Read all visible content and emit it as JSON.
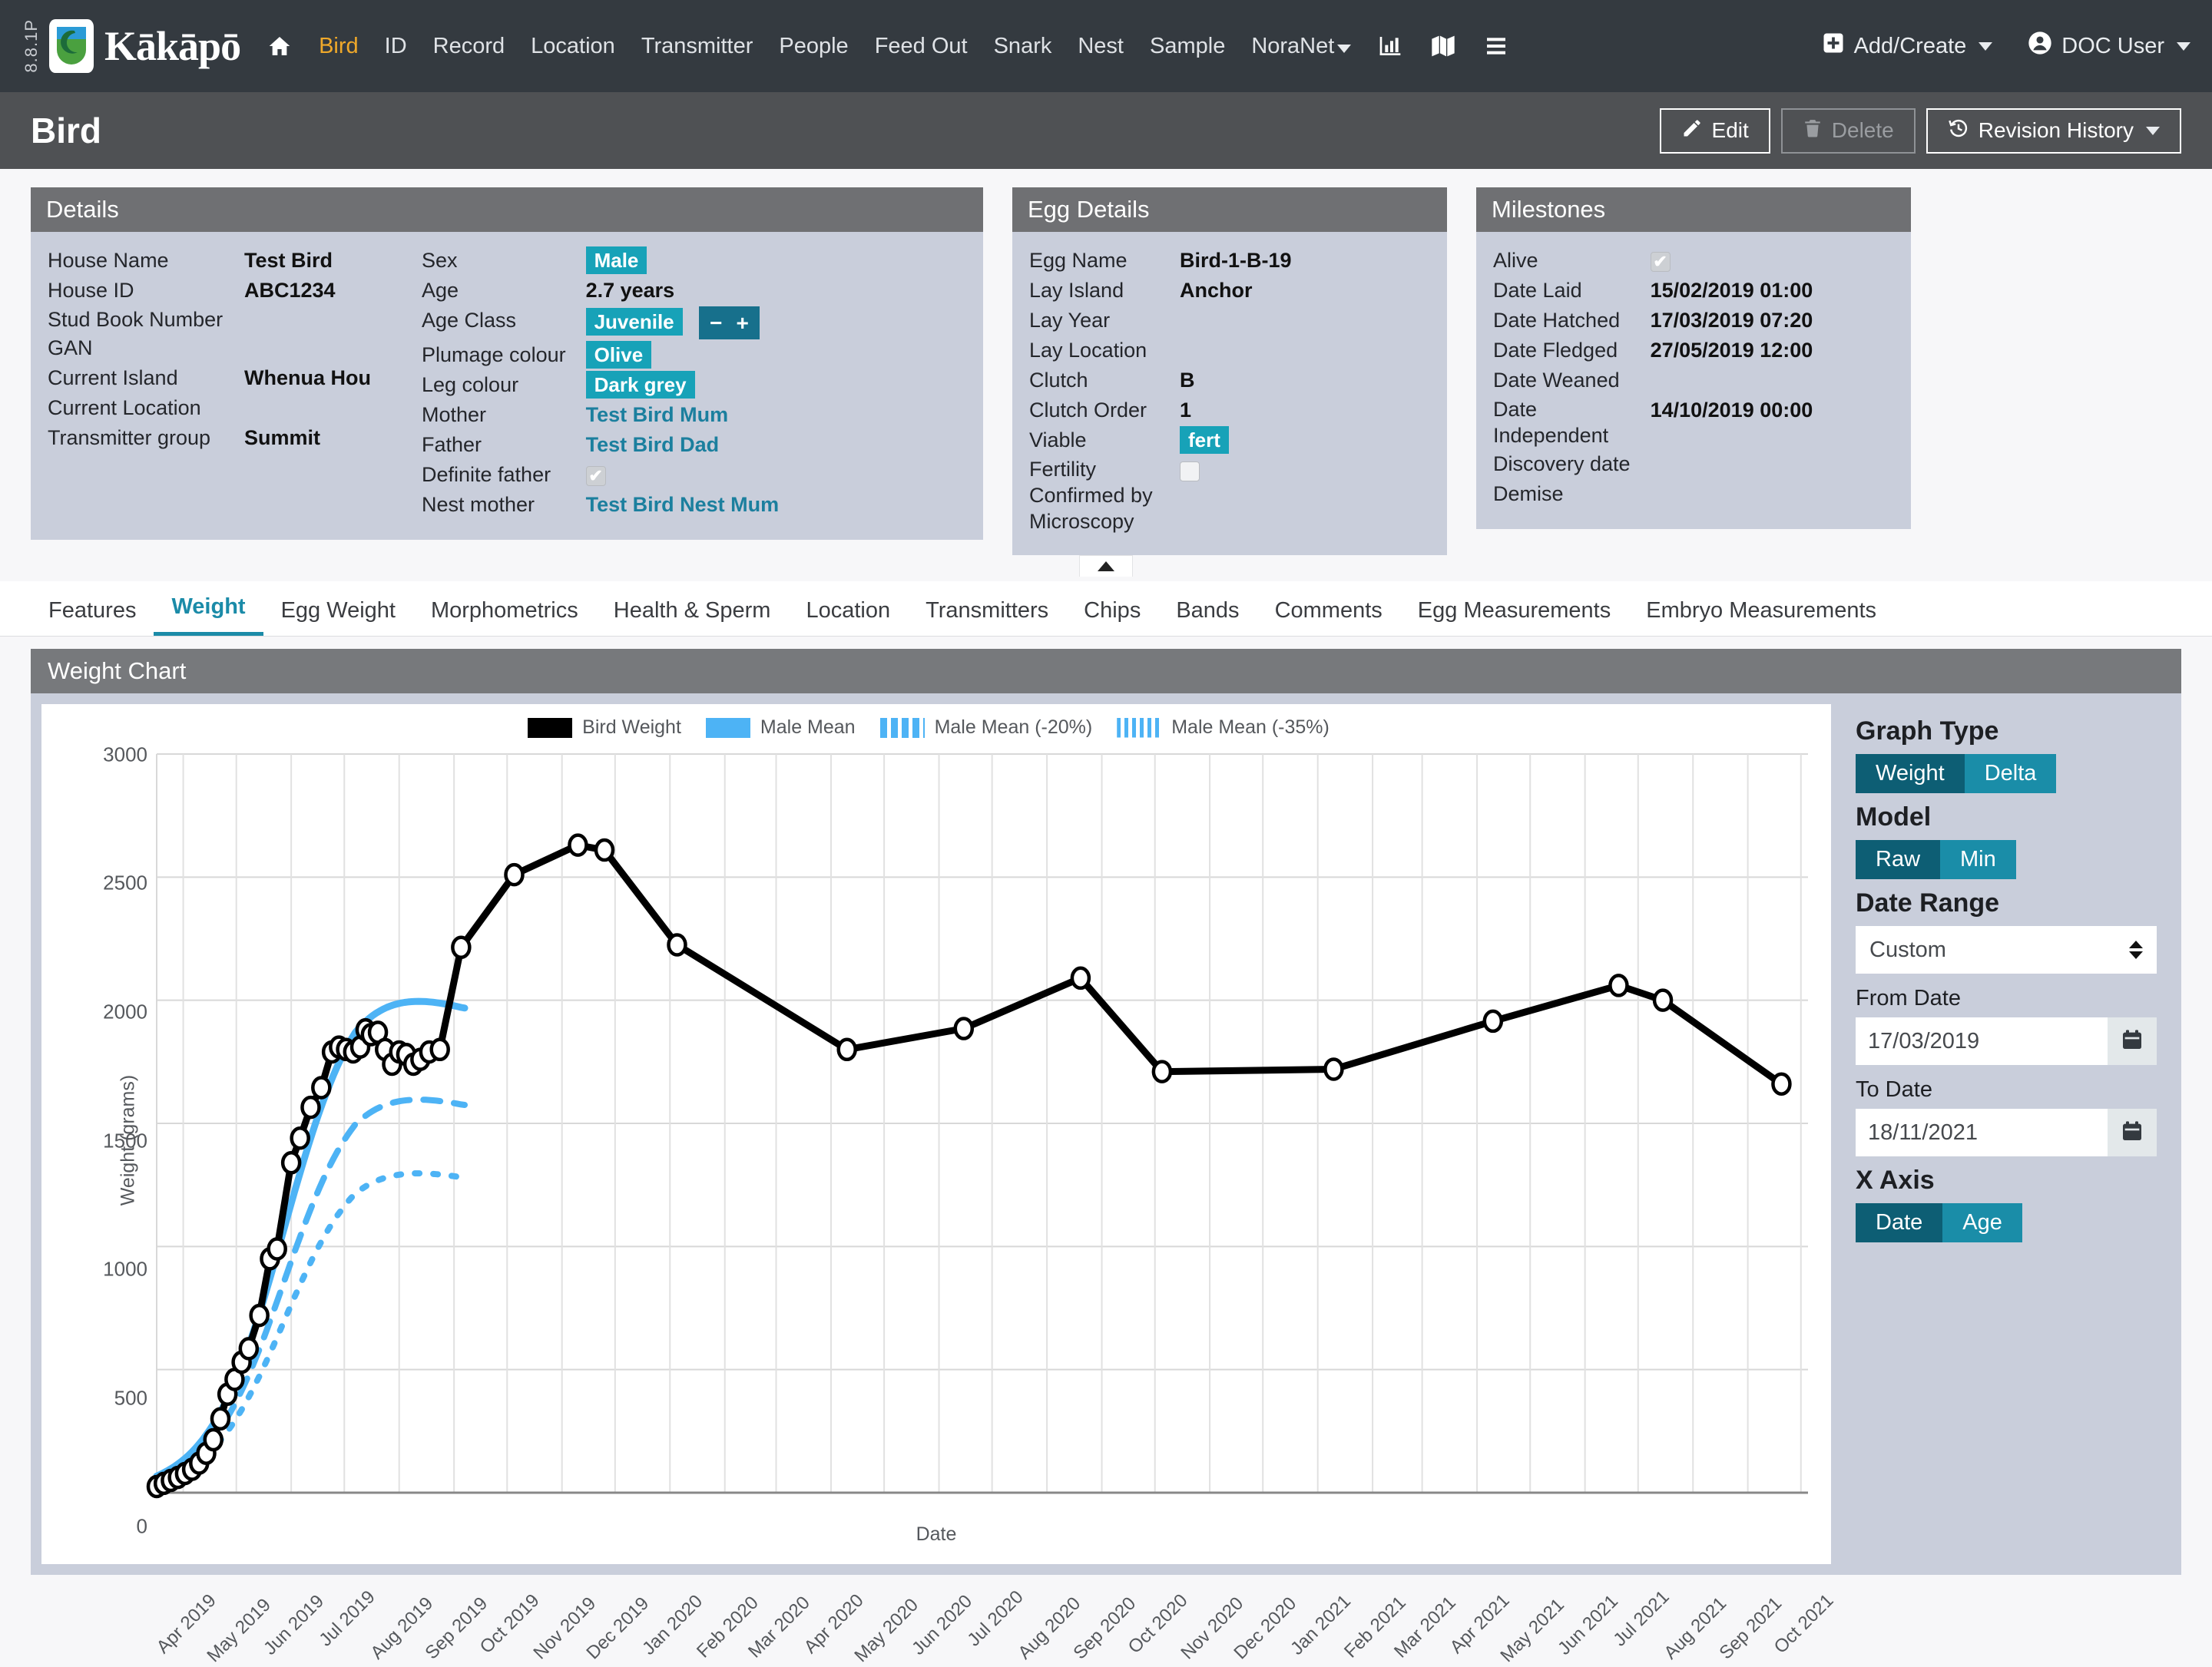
{
  "navbar": {
    "version": "8.8.1P",
    "brand": "Kākāpō",
    "links": [
      {
        "label": "Bird",
        "active": true
      },
      {
        "label": "ID",
        "active": false
      },
      {
        "label": "Record",
        "active": false
      },
      {
        "label": "Location",
        "active": false
      },
      {
        "label": "Transmitter",
        "active": false
      },
      {
        "label": "People",
        "active": false
      },
      {
        "label": "Feed Out",
        "active": false
      },
      {
        "label": "Snark",
        "active": false
      },
      {
        "label": "Nest",
        "active": false
      },
      {
        "label": "Sample",
        "active": false
      },
      {
        "label": "NoraNet",
        "active": false,
        "caret": true
      }
    ],
    "home_icon": "home-icon",
    "chart_icon": "bar-chart-icon",
    "map_icon": "map-icon",
    "list_icon": "list-icon",
    "add_create": "Add/Create",
    "user": "DOC User"
  },
  "page": {
    "title": "Bird",
    "edit": "Edit",
    "delete": "Delete",
    "revision_history": "Revision History"
  },
  "details": {
    "heading": "Details",
    "left": [
      {
        "k": "House Name",
        "v": "Test Bird",
        "bold": true
      },
      {
        "k": "House ID",
        "v": "ABC1234",
        "bold": true
      },
      {
        "k": "Stud Book Number",
        "v": ""
      },
      {
        "k": "GAN",
        "v": ""
      },
      {
        "k": "Current Island",
        "v": "Whenua Hou",
        "bold": true
      },
      {
        "k": "Current Location",
        "v": ""
      },
      {
        "k": "Transmitter group",
        "v": "Summit",
        "bold": true
      }
    ],
    "right": [
      {
        "k": "Sex",
        "v": "Male",
        "type": "badge"
      },
      {
        "k": "Age",
        "v": "2.7 years",
        "type": "text"
      },
      {
        "k": "Age Class",
        "v": "Juvenile",
        "type": "badge_stepper",
        "minus": "−",
        "plus": "+"
      },
      {
        "k": "Plumage colour",
        "v": "Olive",
        "type": "badge"
      },
      {
        "k": "Leg colour",
        "v": "Dark grey",
        "type": "badge"
      },
      {
        "k": "Mother",
        "v": "Test Bird Mum",
        "type": "link"
      },
      {
        "k": "Father",
        "v": "Test Bird Dad",
        "type": "link"
      },
      {
        "k": "Definite father",
        "v": "✔",
        "type": "check"
      },
      {
        "k": "Nest mother",
        "v": "Test Bird Nest Mum",
        "type": "link"
      }
    ]
  },
  "egg": {
    "heading": "Egg Details",
    "rows": [
      {
        "k": "Egg Name",
        "v": "Bird-1-B-19",
        "type": "text"
      },
      {
        "k": "Lay Island",
        "v": "Anchor",
        "type": "text"
      },
      {
        "k": "Lay Year",
        "v": "",
        "type": "text"
      },
      {
        "k": "Lay Location",
        "v": "",
        "type": "text"
      },
      {
        "k": "Clutch",
        "v": "B",
        "type": "text"
      },
      {
        "k": "Clutch Order",
        "v": "1",
        "type": "text"
      },
      {
        "k": "Viable",
        "v": "fert",
        "type": "badge"
      },
      {
        "k": "Fertility Confirmed by Microscopy",
        "v": "",
        "type": "check_empty"
      }
    ]
  },
  "milestones": {
    "heading": "Milestones",
    "rows": [
      {
        "k": "Alive",
        "v": "✔",
        "type": "check"
      },
      {
        "k": "Date Laid",
        "v": "15/02/2019 01:00",
        "type": "text"
      },
      {
        "k": "Date Hatched",
        "v": "17/03/2019 07:20",
        "type": "text"
      },
      {
        "k": "Date Fledged",
        "v": "27/05/2019 12:00",
        "type": "text"
      },
      {
        "k": "Date Weaned",
        "v": "",
        "type": "text"
      },
      {
        "k": "Date Independent",
        "v": "14/10/2019 00:00",
        "type": "text"
      },
      {
        "k": "Discovery date",
        "v": "",
        "type": "text"
      },
      {
        "k": "Demise",
        "v": "",
        "type": "text"
      }
    ]
  },
  "tabs": [
    {
      "label": "Features",
      "active": false
    },
    {
      "label": "Weight",
      "active": true
    },
    {
      "label": "Egg Weight",
      "active": false
    },
    {
      "label": "Morphometrics",
      "active": false
    },
    {
      "label": "Health & Sperm",
      "active": false
    },
    {
      "label": "Location",
      "active": false
    },
    {
      "label": "Transmitters",
      "active": false
    },
    {
      "label": "Chips",
      "active": false
    },
    {
      "label": "Bands",
      "active": false
    },
    {
      "label": "Comments",
      "active": false
    },
    {
      "label": "Egg Measurements",
      "active": false
    },
    {
      "label": "Embryo Measurements",
      "active": false
    }
  ],
  "chart_panel": {
    "heading": "Weight Chart"
  },
  "controls": {
    "graph_type_label": "Graph Type",
    "graph_type_options": [
      "Weight",
      "Delta"
    ],
    "graph_type_selected": "Weight",
    "model_label": "Model",
    "model_options": [
      "Raw",
      "Min"
    ],
    "model_selected": "Raw",
    "date_range_label": "Date Range",
    "date_range_value": "Custom",
    "from_date_label": "From Date",
    "from_date_value": "17/03/2019",
    "to_date_label": "To Date",
    "to_date_value": "18/11/2021",
    "x_axis_label": "X Axis",
    "x_axis_options": [
      "Date",
      "Age"
    ],
    "x_axis_selected": "Date",
    "calendar_icon": "calendar-icon"
  },
  "chart_data": {
    "type": "line",
    "title": "Weight Chart",
    "xlabel": "Date",
    "ylabel": "Weight (grams)",
    "ylim": [
      0,
      3000
    ],
    "yticks": [
      0,
      500,
      1000,
      1500,
      2000,
      2500,
      3000
    ],
    "grid": true,
    "legend_position": "top-center",
    "xticks": [
      "Apr 2019",
      "May 2019",
      "Jun 2019",
      "Jul 2019",
      "Aug 2019",
      "Sep 2019",
      "Oct 2019",
      "Nov 2019",
      "Dec 2019",
      "Jan 2020",
      "Feb 2020",
      "Mar 2020",
      "Apr 2020",
      "May 2020",
      "Jun 2020",
      "Jul 2020",
      "Aug 2020",
      "Sep 2020",
      "Oct 2020",
      "Nov 2020",
      "Dec 2020",
      "Jan 2021",
      "Feb 2021",
      "Mar 2021",
      "Apr 2021",
      "May 2021",
      "Jun 2021",
      "Jul 2021",
      "Aug 2021",
      "Sep 2021"
    ],
    "colors": {
      "bird_weight": "#000000",
      "male_mean": "#4db3f5"
    },
    "series": [
      {
        "name": "Bird Weight",
        "style": "solid-markers",
        "color": "#000000",
        "points": [
          {
            "x": "2019-03-17",
            "y": 25
          },
          {
            "x": "2019-03-21",
            "y": 38
          },
          {
            "x": "2019-03-25",
            "y": 50
          },
          {
            "x": "2019-03-29",
            "y": 62
          },
          {
            "x": "2019-04-02",
            "y": 78
          },
          {
            "x": "2019-04-06",
            "y": 95
          },
          {
            "x": "2019-04-10",
            "y": 120
          },
          {
            "x": "2019-04-14",
            "y": 160
          },
          {
            "x": "2019-04-18",
            "y": 215
          },
          {
            "x": "2019-04-22",
            "y": 300
          },
          {
            "x": "2019-04-26",
            "y": 400
          },
          {
            "x": "2019-04-30",
            "y": 460
          },
          {
            "x": "2019-05-04",
            "y": 530
          },
          {
            "x": "2019-05-08",
            "y": 585
          },
          {
            "x": "2019-05-14",
            "y": 720
          },
          {
            "x": "2019-05-20",
            "y": 950
          },
          {
            "x": "2019-05-24",
            "y": 990
          },
          {
            "x": "2019-06-01",
            "y": 1340
          },
          {
            "x": "2019-06-06",
            "y": 1440
          },
          {
            "x": "2019-06-12",
            "y": 1565
          },
          {
            "x": "2019-06-18",
            "y": 1645
          },
          {
            "x": "2019-06-24",
            "y": 1790
          },
          {
            "x": "2019-06-28",
            "y": 1810
          },
          {
            "x": "2019-07-02",
            "y": 1800
          },
          {
            "x": "2019-07-06",
            "y": 1790
          },
          {
            "x": "2019-07-10",
            "y": 1810
          },
          {
            "x": "2019-07-13",
            "y": 1880
          },
          {
            "x": "2019-07-16",
            "y": 1860
          },
          {
            "x": "2019-07-20",
            "y": 1870
          },
          {
            "x": "2019-07-24",
            "y": 1800
          },
          {
            "x": "2019-07-28",
            "y": 1740
          },
          {
            "x": "2019-08-01",
            "y": 1790
          },
          {
            "x": "2019-08-05",
            "y": 1780
          },
          {
            "x": "2019-08-09",
            "y": 1740
          },
          {
            "x": "2019-08-13",
            "y": 1760
          },
          {
            "x": "2019-08-18",
            "y": 1790
          },
          {
            "x": "2019-08-24",
            "y": 1800
          },
          {
            "x": "2019-09-05",
            "y": 2215
          },
          {
            "x": "2019-10-05",
            "y": 2510
          },
          {
            "x": "2019-11-10",
            "y": 2630
          },
          {
            "x": "2019-11-25",
            "y": 2610
          },
          {
            "x": "2020-01-05",
            "y": 2225
          },
          {
            "x": "2020-04-10",
            "y": 1800
          },
          {
            "x": "2020-06-15",
            "y": 1885
          },
          {
            "x": "2020-08-20",
            "y": 2090
          },
          {
            "x": "2020-10-05",
            "y": 1710
          },
          {
            "x": "2021-01-10",
            "y": 1720
          },
          {
            "x": "2021-04-10",
            "y": 1915
          },
          {
            "x": "2021-06-20",
            "y": 2060
          },
          {
            "x": "2021-07-15",
            "y": 2000
          },
          {
            "x": "2021-09-20",
            "y": 1660
          }
        ]
      },
      {
        "name": "Male Mean",
        "style": "solid",
        "color": "#4db3f5",
        "description": "Reference growth curve rising from ~20 g to a plateau near 2140 g around Jul 2019 then easing to ~1990 g by Sep 2019"
      },
      {
        "name": "Male Mean (-20%)",
        "style": "dashed",
        "color": "#4db3f5",
        "description": "Male Mean scaled to 80%, peaking near 1710 g"
      },
      {
        "name": "Male Mean (-35%)",
        "style": "dotted",
        "color": "#4db3f5",
        "description": "Male Mean scaled to 65%, peaking near 1390 g"
      }
    ],
    "legend": [
      {
        "label": "Bird Weight",
        "color": "#000000",
        "style": "solid"
      },
      {
        "label": "Male Mean",
        "color": "#4db3f5",
        "style": "solid"
      },
      {
        "label": "Male Mean (-20%)",
        "color": "#4db3f5",
        "style": "dashed"
      },
      {
        "label": "Male Mean (-35%)",
        "color": "#4db3f5",
        "style": "dotted"
      }
    ]
  }
}
